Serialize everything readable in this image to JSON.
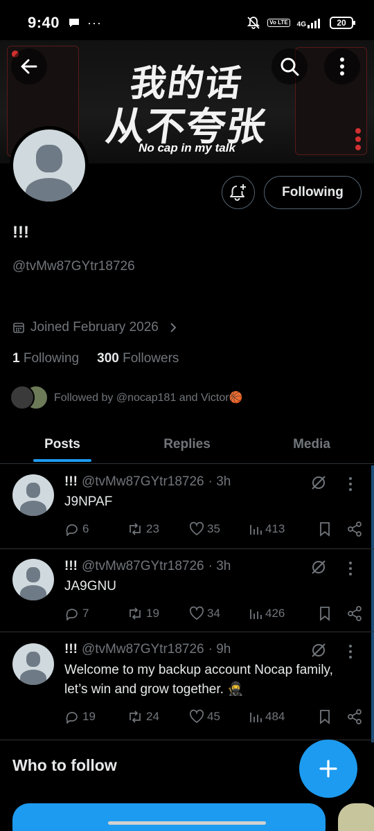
{
  "status_bar": {
    "time": "9:40",
    "volte": "Vo LTE",
    "network": "4G",
    "battery": "20"
  },
  "banner": {
    "title_line_1": "我的话",
    "title_line_2": "从不夸张",
    "subtitle": "No cap in my talk"
  },
  "profile": {
    "display_name": "!!!",
    "handle": "@tvMw87GYtr18726",
    "joined": "Joined February 2026",
    "following_count": "1",
    "following_label": "Following",
    "followers_count": "300",
    "followers_label": "Followers",
    "followed_by": "Followed by @nocap181 and Victor🏀",
    "follow_button_label": "Following"
  },
  "tabs": [
    {
      "label": "Posts",
      "active": true
    },
    {
      "label": "Replies",
      "active": false
    },
    {
      "label": "Media",
      "active": false
    }
  ],
  "posts": [
    {
      "name": "!!!",
      "handle": "@tvMw87GYtr18726",
      "time": "· 3h",
      "text": "J9NPAF",
      "replies": "6",
      "reposts": "23",
      "likes": "35",
      "views": "413"
    },
    {
      "name": "!!!",
      "handle": "@tvMw87GYtr18726",
      "time": "· 3h",
      "text": "JA9GNU",
      "replies": "7",
      "reposts": "19",
      "likes": "34",
      "views": "426"
    },
    {
      "name": "!!!",
      "handle": "@tvMw87GYtr18726",
      "time": "· 9h",
      "text": "Welcome to my backup account Nocap family, let’s win and grow together. 🥷",
      "replies": "19",
      "reposts": "24",
      "likes": "45",
      "views": "484"
    }
  ],
  "who_to_follow": "Who to follow",
  "colors": {
    "accent": "#1d9bf0",
    "muted_text": "#71767b",
    "border": "#2f3336"
  },
  "icons": [
    "back-arrow-icon",
    "search-icon",
    "more-vertical-icon",
    "bell-plus-icon",
    "calendar-icon",
    "chevron-right-icon",
    "reply-icon",
    "repost-icon",
    "like-icon",
    "views-icon",
    "bookmark-icon",
    "share-icon",
    "grok-icon",
    "compose-plus-icon"
  ]
}
